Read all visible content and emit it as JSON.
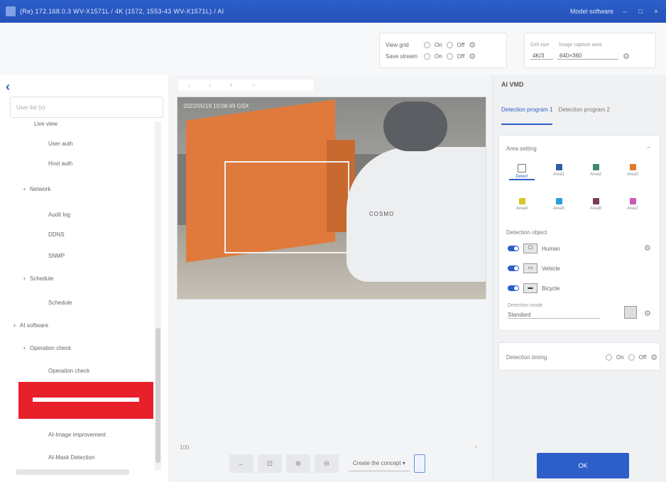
{
  "titlebar": {
    "title": "(Re) 172.168.0.3 WV-X1571L / 4K (1572, 1553-43 WV-X1571L) / AI",
    "right_label": "Model software",
    "minimize": "–",
    "maximize": "□",
    "close": "×"
  },
  "toolbar": {
    "view_grid": "View grid",
    "save_stream": "Save stream",
    "on": "On",
    "off": "Off",
    "cell_size_label": "Cell size",
    "cell_size_value": "4K/3",
    "image_label": "Image capture area",
    "image_value": "640×360"
  },
  "left": {
    "back": "‹",
    "search_placeholder": "User list (s)",
    "tree": [
      "Live view",
      "User auth",
      "Host auth",
      "Network",
      "Audit log",
      "DDNS",
      "SNMP",
      "Schedule",
      "Schedule",
      "AI software",
      "Operation check",
      "Operation check",
      "AI-Image improvement",
      "AI-Mask Detection"
    ]
  },
  "center": {
    "tabs": [
      "‹",
      "›",
      "+",
      "−"
    ],
    "video_overlay": "2022/05/19 10:08:49 GSX",
    "video_logo": "COSMO",
    "zoom_label": "100",
    "collapse": "‹",
    "ctrl_buttons": [
      "←",
      "⊡",
      "⊕",
      "⊖"
    ],
    "select_label": "Create the concept",
    "select_arrow": "▾"
  },
  "right": {
    "title": "AI VMD",
    "tabs": [
      "Detection program 1",
      "Detection program 2"
    ],
    "area_setting": "Area setting",
    "areas": [
      "Detect",
      "Area1",
      "Area2",
      "Area3",
      "Area4",
      "Area5",
      "Area6",
      "Area7"
    ],
    "area_colors": [
      "#ffffff",
      "#2f5fa8",
      "#3e8a6c",
      "#e07a2a",
      "#d8c62b",
      "#2aa0d8",
      "#7a3a5a",
      "#c85ab8"
    ],
    "detection_object": "Detection object",
    "objects": [
      {
        "icon": "☐",
        "label": "Human"
      },
      {
        "icon": "▭",
        "label": "Vehicle"
      },
      {
        "icon": "▬",
        "label": "Bicycle"
      }
    ],
    "sensitivity_label": "Detection mode",
    "sensitivity_value": "Standard",
    "detection_timing": "Detection timing",
    "on": "On",
    "off": "Off",
    "ok": "OK",
    "collapse": "−"
  }
}
